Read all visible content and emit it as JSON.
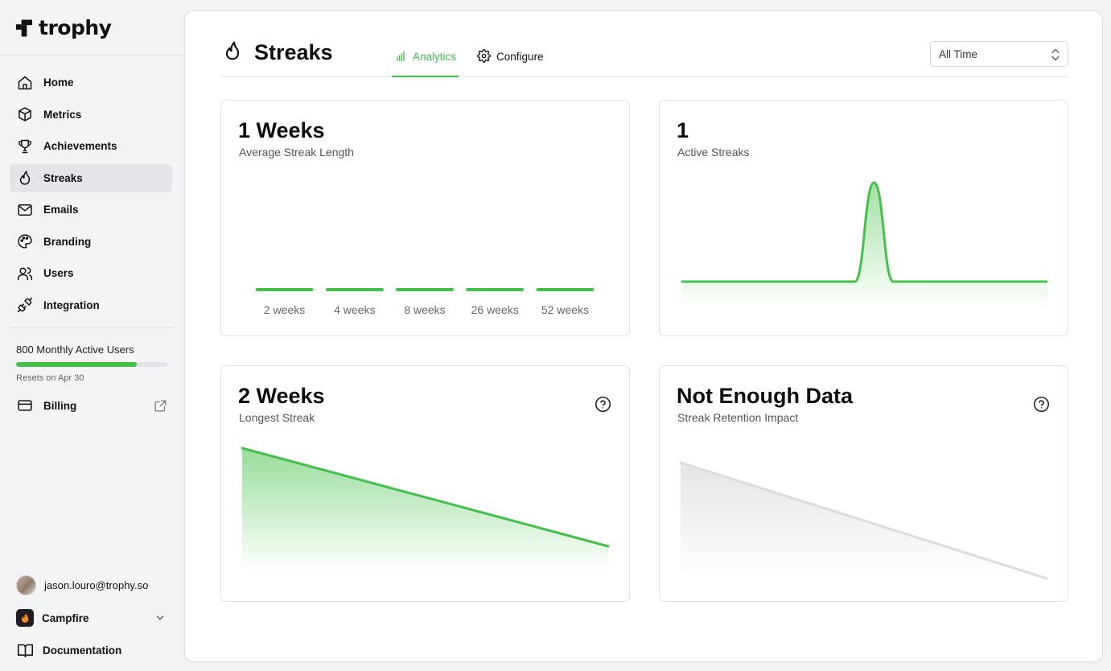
{
  "app": {
    "name": "trophy"
  },
  "sidebar": {
    "items": [
      {
        "label": "Home",
        "icon": "home-icon"
      },
      {
        "label": "Metrics",
        "icon": "cube-icon"
      },
      {
        "label": "Achievements",
        "icon": "trophy-icon"
      },
      {
        "label": "Streaks",
        "icon": "flame-icon",
        "active": true
      },
      {
        "label": "Emails",
        "icon": "mail-icon"
      },
      {
        "label": "Branding",
        "icon": "palette-icon"
      },
      {
        "label": "Users",
        "icon": "users-icon"
      },
      {
        "label": "Integration",
        "icon": "plug-icon"
      }
    ],
    "usage": {
      "label": "800 Monthly Active Users",
      "progress": 0.8,
      "reset": "Resets on Apr 30"
    },
    "billing": {
      "label": "Billing"
    },
    "user": {
      "email": "jason.louro@trophy.so"
    },
    "org": {
      "name": "Campfire"
    },
    "docs": {
      "label": "Documentation"
    }
  },
  "header": {
    "title": "Streaks",
    "tabs": [
      {
        "label": "Analytics",
        "active": true
      },
      {
        "label": "Configure"
      }
    ],
    "range_select": {
      "value": "All Time"
    }
  },
  "cards": {
    "avg_length": {
      "value": "1 Weeks",
      "label": "Average Streak Length"
    },
    "active": {
      "value": "1",
      "label": "Active Streaks"
    },
    "longest": {
      "value": "2 Weeks",
      "label": "Longest Streak"
    },
    "retention": {
      "value": "Not Enough Data",
      "label": "Streak Retention Impact"
    }
  },
  "colors": {
    "accent": "#45c04a",
    "muted": "#dcdcdc",
    "text": "#111111"
  },
  "chart_data": [
    {
      "type": "bar",
      "categories": [
        "2 weeks",
        "4 weeks",
        "8 weeks",
        "26 weeks",
        "52 weeks"
      ],
      "values": [
        0,
        0,
        0,
        0,
        0
      ]
    },
    {
      "type": "area",
      "values": [
        0,
        0,
        0,
        0,
        0,
        0,
        0,
        0,
        0,
        0,
        1,
        0,
        0,
        0,
        0,
        0,
        0,
        0,
        0,
        0
      ]
    },
    {
      "type": "area",
      "values": [
        2,
        1
      ]
    },
    {
      "type": "area",
      "values": [
        2,
        1
      ]
    }
  ]
}
